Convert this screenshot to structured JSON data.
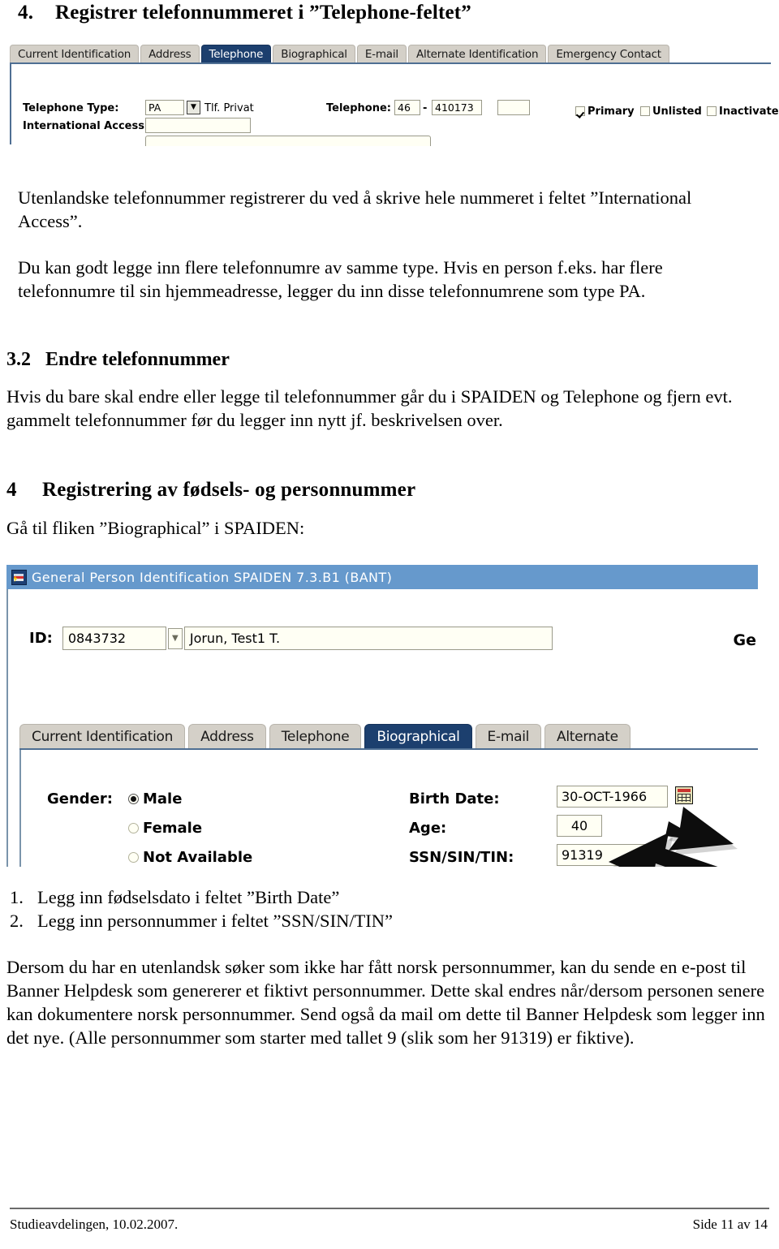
{
  "document": {
    "heading_4_telephone": {
      "number": "4.",
      "text": "Registrer telefonnummeret i ”Telephone-feltet”"
    },
    "paragraph_international": "Utenlandske telefonnummer registrerer du ved å skrive hele nummeret i feltet ”International Access”.",
    "paragraph_multiple_numbers": "Du kan godt legge inn flere telefonnumre av samme type. Hvis en person f.eks. har flere telefonnumre til sin hjemmeadresse, legger du inn disse telefonnumrene som type PA.",
    "heading_3_2": {
      "number": "3.2",
      "text": "Endre telefonnummer"
    },
    "paragraph_endre": "Hvis du bare skal endre eller legge til telefonnummer går du i SPAIDEN og Telephone og fjern evt. gammelt telefonnummer før du legger inn nytt jf. beskrivelsen over.",
    "heading_4_registrering": {
      "number": "4",
      "text": "Registrering av fødsels- og personnummer"
    },
    "paragraph_ga_til_fliken": "Gå til fliken ”Biographical” i SPAIDEN:",
    "numbered_steps": [
      {
        "marker": "1.",
        "text": "Legg inn fødselsdato i feltet ”Birth Date”"
      },
      {
        "marker": "2.",
        "text": "Legg inn personnummer i feltet ”SSN/SIN/TIN”"
      }
    ],
    "paragraph_utenlandsk": "Dersom du har en utenlandsk søker som ikke har fått norsk personnummer, kan du sende en e-post til Banner Helpdesk som genererer et fiktivt personnummer. Dette skal endres når/dersom personen senere kan dokumentere norsk personnummer. Send også da mail om dette til Banner Helpdesk som legger inn det nye. (Alle personnummer som starter med tallet 9 (slik som her 91319) er fiktive).",
    "footer": {
      "left": "Studieavdelingen, 10.02.2007.",
      "right": "Side 11 av 14"
    }
  },
  "screenshot_telephone": {
    "tabs": [
      {
        "label": "Current Identification",
        "active": false
      },
      {
        "label": "Address",
        "active": false
      },
      {
        "label": "Telephone",
        "active": true
      },
      {
        "label": "Biographical",
        "active": false
      },
      {
        "label": "E-mail",
        "active": false
      },
      {
        "label": "Alternate Identification",
        "active": false
      },
      {
        "label": "Emergency Contact",
        "active": false
      }
    ],
    "fields": {
      "telephone_type_label": "Telephone Type:",
      "telephone_type_code": "PA",
      "telephone_type_desc": "Tlf. Privat",
      "international_access_label": "International Access:",
      "international_access_value": "",
      "telephone_label": "Telephone:",
      "telephone_area": "46",
      "telephone_separator": "-",
      "telephone_number": "410173",
      "telephone_ext": ""
    },
    "checkboxes": [
      {
        "label": "Primary",
        "checked": true
      },
      {
        "label": "Unlisted",
        "checked": false
      },
      {
        "label": "Inactivate",
        "checked": false
      }
    ],
    "colors": {
      "active_tab": "#1c3f6e",
      "inactive_tab": "#d4d0c8",
      "field_bg": "#fffff4"
    }
  },
  "screenshot_biographical": {
    "window_title": "General Person Identification  SPAIDEN  7.3.B1  (BANT)",
    "id_label": "ID:",
    "id_value": "0843732",
    "name_value": "Jorun, Test1 T.",
    "partial_right_text": "Ge",
    "tabs": [
      {
        "label": "Current Identification",
        "active": false
      },
      {
        "label": "Address",
        "active": false
      },
      {
        "label": "Telephone",
        "active": false
      },
      {
        "label": "Biographical",
        "active": true
      },
      {
        "label": "E-mail",
        "active": false
      },
      {
        "label": "Alternate",
        "active": false
      }
    ],
    "gender": {
      "label": "Gender:",
      "options": [
        {
          "label": "Male",
          "selected": true
        },
        {
          "label": "Female",
          "selected": false
        },
        {
          "label": "Not Available",
          "selected": false
        }
      ]
    },
    "fields": [
      {
        "label": "Birth Date:",
        "value": "30-OCT-1966"
      },
      {
        "label": "Age:",
        "value": "40"
      },
      {
        "label": "SSN/SIN/TIN:",
        "value": "91319"
      }
    ],
    "annotations": [
      {
        "name": "arrow-to-birth-date",
        "points_to": "Birth Date:"
      },
      {
        "name": "arrow-to-ssn",
        "points_to": "SSN/SIN/TIN:"
      }
    ],
    "colors": {
      "title_bar": "#6699cc",
      "active_tab": "#1c3f6e",
      "inactive_tab": "#d4d0c8",
      "field_bg": "#fffff4"
    }
  }
}
